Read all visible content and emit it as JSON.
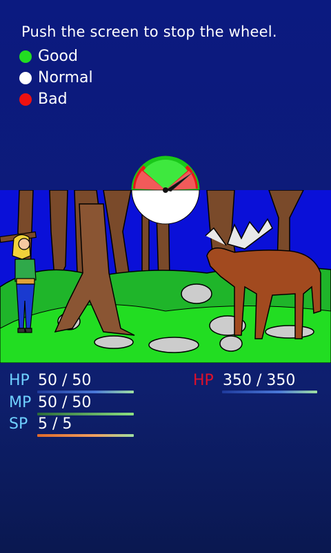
{
  "instructions": "Push the screen to stop the wheel.",
  "legend": [
    {
      "label": "Good",
      "color": "#22dd22"
    },
    {
      "label": "Normal",
      "color": "#ffffff"
    },
    {
      "label": "Bad",
      "color": "#ee1111"
    }
  ],
  "wheel": {
    "segments": [
      "Good",
      "Bad",
      "Normal"
    ]
  },
  "player": {
    "hp": {
      "label": "HP",
      "value": "50 / 50",
      "fraction": 1.0
    },
    "mp": {
      "label": "MP",
      "value": "50 / 50",
      "fraction": 1.0
    },
    "sp": {
      "label": "SP",
      "value": "5 / 5",
      "fraction": 1.0
    }
  },
  "enemy": {
    "hp": {
      "label": "HP",
      "value": "350 / 350",
      "fraction": 1.0
    }
  },
  "colors": {
    "player_label": "#6fd0ff",
    "enemy_label": "#e0102a",
    "hp_bar": "#4a78d8",
    "mp_bar": "#8de080",
    "sp_bar": "#e07a3a"
  }
}
